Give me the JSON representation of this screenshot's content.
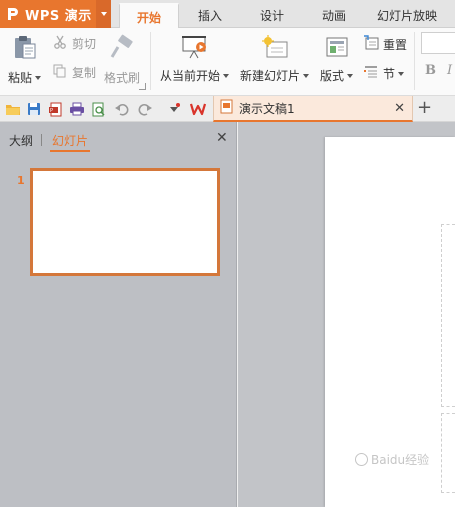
{
  "app": {
    "title": "WPS 演示"
  },
  "tabs": [
    {
      "label": "开始",
      "active": true
    },
    {
      "label": "插入",
      "active": false
    },
    {
      "label": "设计",
      "active": false
    },
    {
      "label": "动画",
      "active": false
    },
    {
      "label": "幻灯片放映",
      "active": false
    }
  ],
  "ribbon": {
    "paste": "粘贴",
    "cut": "剪切",
    "copy": "复制",
    "format_painter": "格式刷",
    "from_current": "从当前开始",
    "new_slide": "新建幻灯片",
    "layout": "版式",
    "reset": "重置",
    "section": "节",
    "bold": "B",
    "italic": "I"
  },
  "doc_tab": {
    "title": "演示文稿1"
  },
  "left_pane": {
    "tab_outline": "大纲",
    "tab_slides": "幻灯片",
    "slide_number": "1"
  },
  "watermark": {
    "text": "Baidu经验"
  },
  "colors": {
    "accent": "#e8762e",
    "pane_bg": "#bdbfc4",
    "work_bg": "#c2c4c8"
  }
}
